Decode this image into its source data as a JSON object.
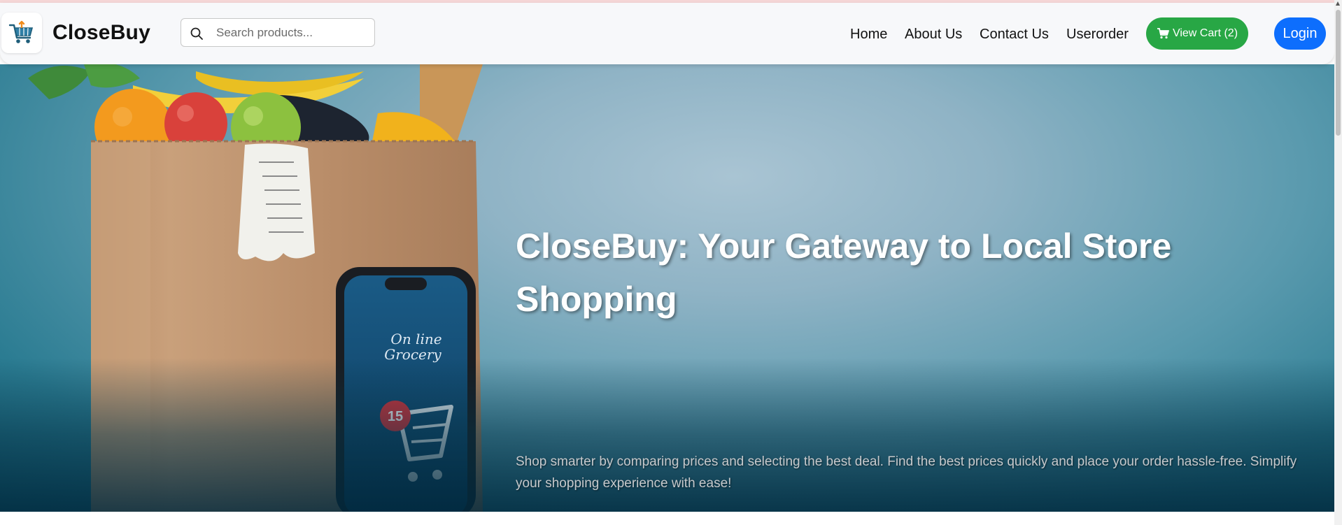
{
  "navbar": {
    "brand": "CloseBuy",
    "logo_icon": "shopping-cart-logo-icon",
    "search": {
      "placeholder": "Search products...",
      "value": "",
      "icon": "search-icon"
    },
    "links": [
      {
        "label": "Home"
      },
      {
        "label": "About Us"
      },
      {
        "label": "Contact Us"
      },
      {
        "label": "Userorder"
      }
    ],
    "cart_button": {
      "label": "View Cart (2)",
      "icon": "cart-icon",
      "color": "#28a745"
    },
    "login_button": {
      "label": "Login",
      "color": "#0d6efd"
    }
  },
  "hero": {
    "title": "CloseBuy: Your Gateway to Local Store Shopping",
    "subtitle": "Shop smarter by comparing prices and selecting the best deal. Find the best prices quickly and place your order hassle-free. Simplify your shopping experience with ease!",
    "image": {
      "phone_text": "On line\nGrocery",
      "badge_count": "15"
    }
  }
}
